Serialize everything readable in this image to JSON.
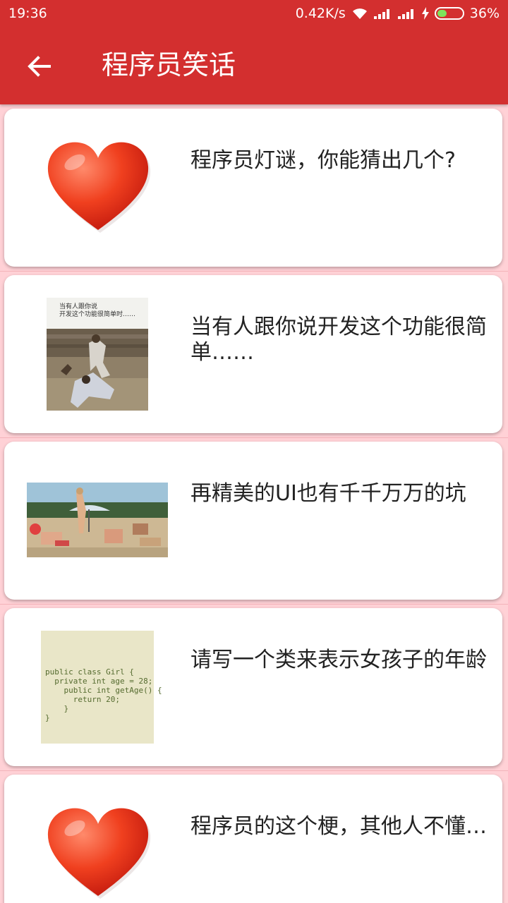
{
  "status_bar": {
    "time": "19:36",
    "net_speed": "0.42K/s",
    "battery_pct": "36%",
    "battery_level": 0.36
  },
  "toolbar": {
    "back_icon": "arrow-left-icon",
    "title": "程序员笑话"
  },
  "items": [
    {
      "title": "程序员灯谜，你能猜出几个?",
      "thumb": "heart"
    },
    {
      "title": "当有人跟你说开发这个功能很简单……",
      "thumb": "fight-photo",
      "thumb_caption_1": "当有人跟你说",
      "thumb_caption_2": "开发这个功能很简单时……"
    },
    {
      "title": "再精美的UI也有千千万万的坑",
      "thumb": "beach-photo"
    },
    {
      "title": "请写一个类来表示女孩子的年龄",
      "thumb": "code-image",
      "code_lines": [
        "public class Girl {",
        "  private int age = 28;",
        "    public int getAge() {",
        "      return 20;",
        "    }",
        "}"
      ]
    },
    {
      "title": "程序员的这个梗，其他人不懂…",
      "thumb": "heart"
    }
  ],
  "colors": {
    "primary": "#d32f2f",
    "background": "#ffd1d6",
    "card": "#ffffff"
  }
}
